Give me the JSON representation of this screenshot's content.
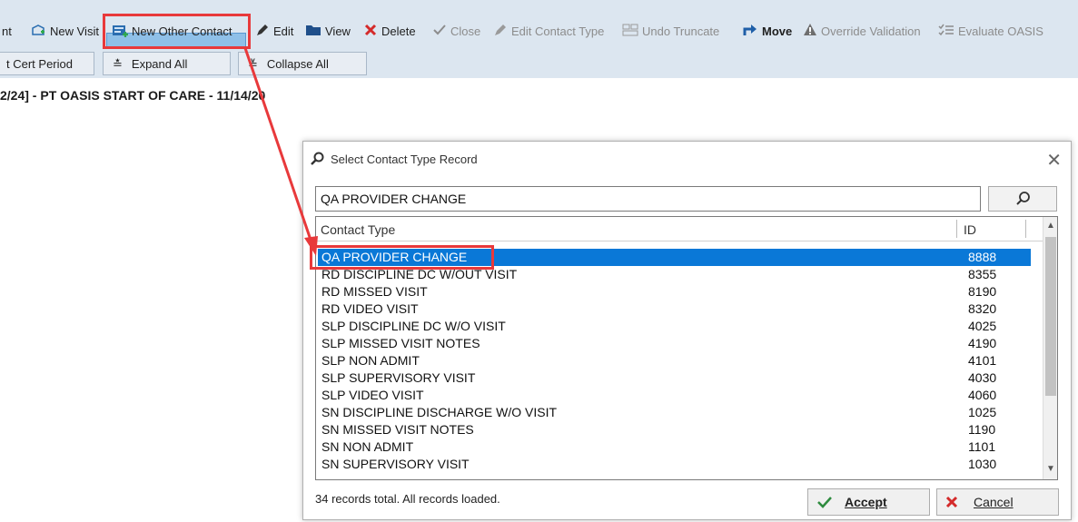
{
  "toolbar": {
    "contact_label": "nt",
    "new_visit_label": "New Visit",
    "new_other_contact_label": "New Other Contact",
    "edit_label": "Edit",
    "view_label": "View",
    "delete_label": "Delete",
    "close_label": "Close",
    "edit_contact_type_label": "Edit Contact Type",
    "undo_truncate_label": "Undo Truncate",
    "move_label": "Move",
    "override_validation_label": "Override Validation",
    "evaluate_oasis_label": "Evaluate OASIS"
  },
  "toolbar2": {
    "cert_period_label": "t Cert Period",
    "expand_all_label": "Expand All",
    "collapse_all_label": "Collapse All"
  },
  "visit_line": "2/24]  - PT OASIS START OF CARE - 11/14/20",
  "dialog": {
    "title": "Select Contact Type Record",
    "search_value": "QA PROVIDER CHANGE",
    "col_contact_type": "Contact Type",
    "col_id": "ID",
    "rows": [
      {
        "name": "QA PROVIDER CHANGE",
        "id": "8888",
        "selected": true
      },
      {
        "name": "RD DISCIPLINE DC W/OUT VISIT",
        "id": "8355"
      },
      {
        "name": "RD MISSED VISIT",
        "id": "8190"
      },
      {
        "name": "RD VIDEO VISIT",
        "id": "8320"
      },
      {
        "name": "SLP DISCIPLINE DC W/O VISIT",
        "id": "4025"
      },
      {
        "name": "SLP MISSED VISIT NOTES",
        "id": "4190"
      },
      {
        "name": "SLP NON ADMIT",
        "id": "4101"
      },
      {
        "name": "SLP SUPERVISORY VISIT",
        "id": "4030"
      },
      {
        "name": "SLP VIDEO VISIT",
        "id": "4060"
      },
      {
        "name": "SN DISCIPLINE DISCHARGE W/O VISIT",
        "id": "1025"
      },
      {
        "name": "SN MISSED VISIT NOTES",
        "id": "1190"
      },
      {
        "name": "SN NON ADMIT",
        "id": "1101"
      },
      {
        "name": "SN SUPERVISORY VISIT",
        "id": "1030"
      }
    ],
    "status": "34 records total. All records loaded.",
    "accept_label": "Accept",
    "cancel_label": "Cancel"
  },
  "colors": {
    "toolbar_bg": "#dce6f0",
    "highlight_box": "#e8393b",
    "selected_row": "#0a78d7"
  }
}
